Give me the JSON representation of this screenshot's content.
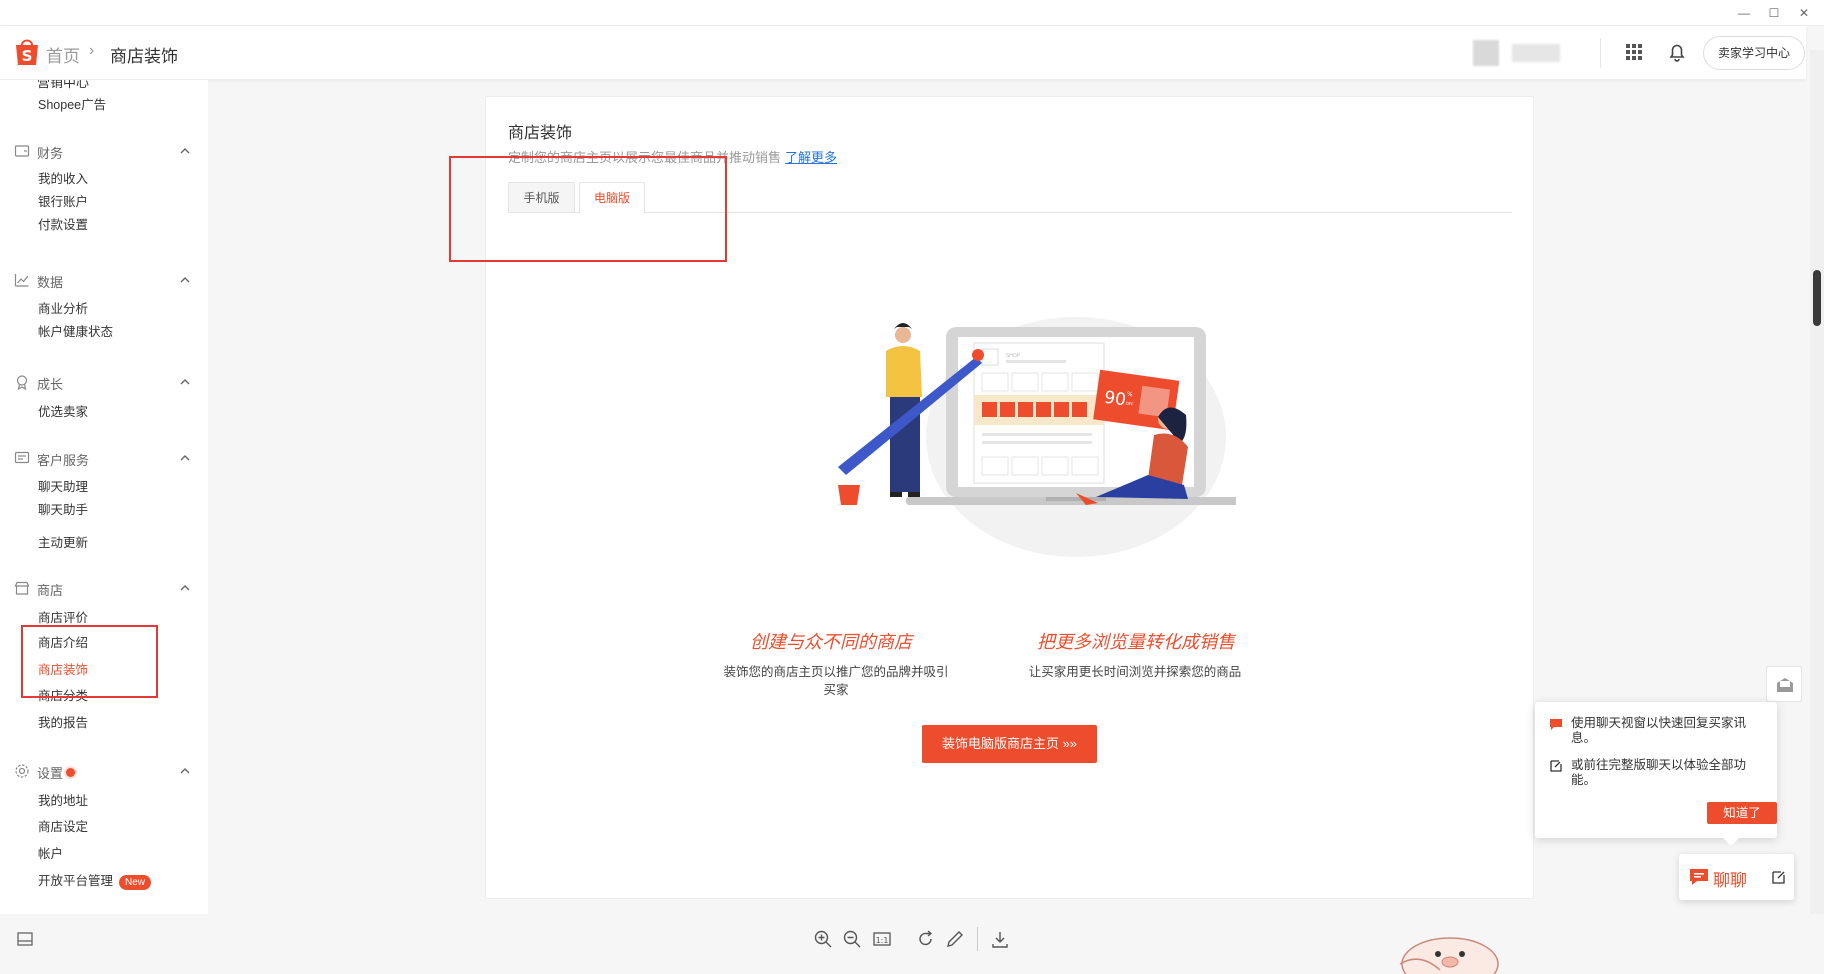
{
  "header": {
    "breadcrumb_home": "首页",
    "breadcrumb_sep": "›",
    "breadcrumb_current": "商店装饰",
    "learning_center": "卖家学习中心"
  },
  "sidebar": {
    "cut_item": "营销中心",
    "items_top": [
      {
        "label": "Shopee广告"
      }
    ],
    "groups": [
      {
        "label": "财务",
        "icon": "finance-icon",
        "items": [
          {
            "label": "我的收入"
          },
          {
            "label": "银行账户"
          },
          {
            "label": "付款设置"
          }
        ]
      },
      {
        "label": "数据",
        "icon": "chart-icon",
        "items": [
          {
            "label": "商业分析"
          },
          {
            "label": "帐户健康状态"
          }
        ]
      },
      {
        "label": "成长",
        "icon": "growth-icon",
        "items": [
          {
            "label": "优选卖家"
          }
        ]
      },
      {
        "label": "客户服务",
        "icon": "service-icon",
        "items": [
          {
            "label": "聊天助理"
          },
          {
            "label": "聊天助手"
          },
          {
            "label": "主动更新"
          }
        ]
      },
      {
        "label": "商店",
        "icon": "shop-icon",
        "items": [
          {
            "label": "商店评价"
          },
          {
            "label": "商店介绍"
          },
          {
            "label": "商店装饰"
          },
          {
            "label": "商店分类"
          },
          {
            "label": "我的报告"
          }
        ]
      },
      {
        "label": "设置",
        "icon": "settings-icon",
        "items": [
          {
            "label": "我的地址"
          },
          {
            "label": "商店设定"
          },
          {
            "label": "帐户"
          },
          {
            "label": "开放平台管理",
            "badge": "New"
          }
        ]
      }
    ]
  },
  "main": {
    "title": "商店装饰",
    "description": "定制您的商店主页以展示您最佳商品并推动销售",
    "learn_more": "了解更多",
    "tabs": [
      {
        "label": "手机版"
      },
      {
        "label": "电脑版",
        "active": true
      }
    ],
    "illustration": {
      "shop_label": "SHOP",
      "discount": "90",
      "discount_unit": "%",
      "discount_off": "OFF"
    },
    "features": [
      {
        "title": "创建与众不同的商店",
        "desc_line1": "装饰您的商店主页以推广您的品牌并吸引",
        "desc_line2": "买家"
      },
      {
        "title": "把更多浏览量转化成销售",
        "desc_line1": "让买家用更长时间浏览并探索您的商品",
        "desc_line2": ""
      }
    ],
    "cta": "装饰电脑版商店主页 »»"
  },
  "chat": {
    "tip1": "使用聊天视窗以快速回复买家讯息。",
    "tip2": "或前往完整版聊天以体验全部功能。",
    "tip_btn": "知道了",
    "chat_label": "聊聊"
  },
  "colors": {
    "accent": "#ee4d2d",
    "link": "#2673dd",
    "annotation": "#e53935"
  }
}
